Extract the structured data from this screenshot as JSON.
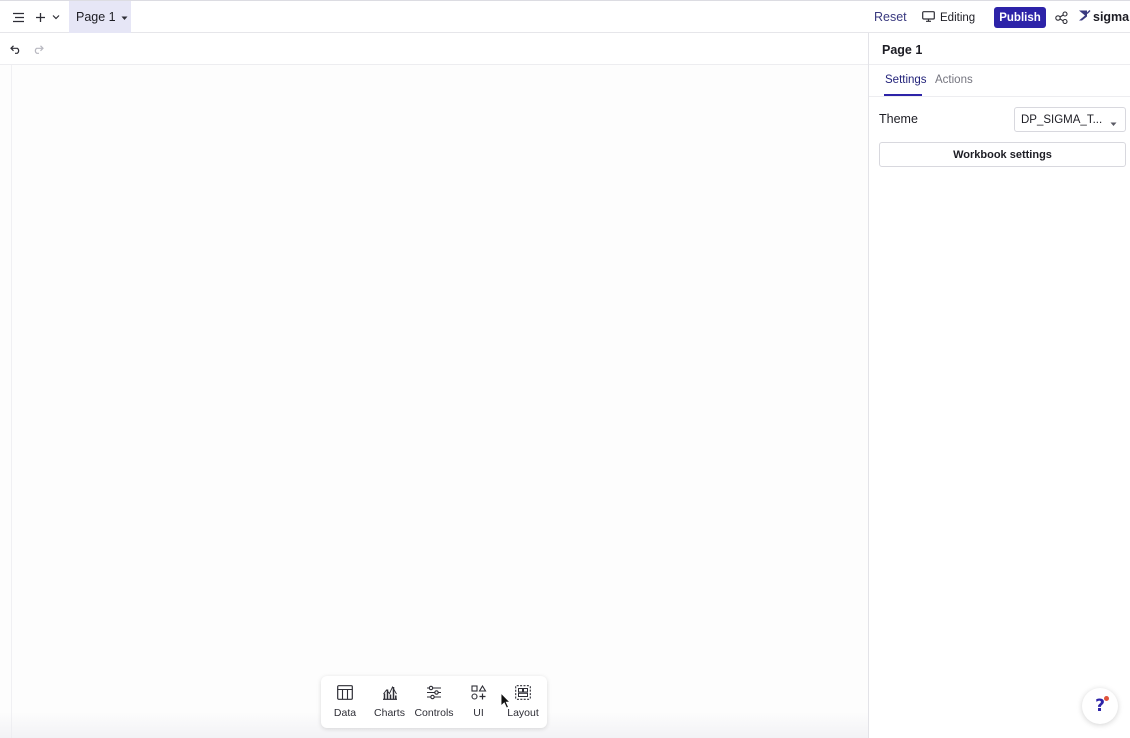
{
  "topbar": {
    "page_tab_label": "Page 1",
    "reset_label": "Reset",
    "editing_label": "Editing",
    "publish_label": "Publish",
    "brand_label": "sigma",
    "icons": [
      "menu-icon",
      "add-icon",
      "chevron-down-icon",
      "monitor-icon",
      "share-icon",
      "sigma-logo-icon"
    ]
  },
  "canvas": {
    "icons": [
      "undo-icon",
      "redo-icon"
    ]
  },
  "element_toolbar": {
    "items": [
      {
        "label": "Data",
        "icon": "table-icon"
      },
      {
        "label": "Charts",
        "icon": "chart-icon"
      },
      {
        "label": "Controls",
        "icon": "sliders-icon"
      },
      {
        "label": "UI",
        "icon": "shapes-icon"
      },
      {
        "label": "Layout",
        "icon": "layout-icon"
      }
    ]
  },
  "panel": {
    "title": "Page 1",
    "tabs": [
      {
        "label": "Settings",
        "active": true
      },
      {
        "label": "Actions",
        "active": false
      }
    ],
    "theme_label": "Theme",
    "theme_value": "DP_SIGMA_T...",
    "workbook_settings_label": "Workbook settings"
  },
  "help": {
    "label": "?"
  },
  "colors": {
    "accent": "#2d23a8",
    "page_tab_bg": "#e6e6f6",
    "help_dot": "#e0533c"
  }
}
